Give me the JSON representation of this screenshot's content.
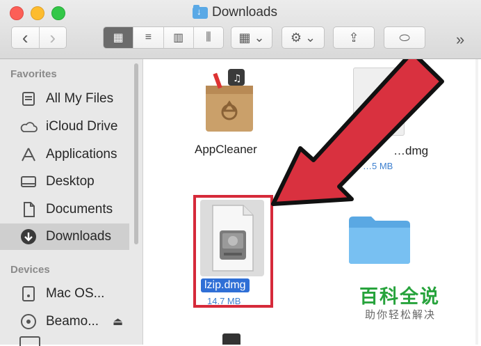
{
  "window": {
    "title": "Downloads"
  },
  "toolbar": {
    "back": "‹",
    "forward": "›",
    "view_icon": "▦",
    "view_list": "≡",
    "view_columns": "▥",
    "view_coverflow": "⫼",
    "arrange": "▦ ⌄",
    "action": "⚙ ⌄",
    "share": "⇪",
    "tags": "⬭",
    "overflow": "»"
  },
  "sidebar": {
    "favorites_header": "Favorites",
    "devices_header": "Devices",
    "favorites": [
      {
        "label": "All My Files",
        "icon": "all-my-files-icon"
      },
      {
        "label": "iCloud Drive",
        "icon": "cloud-icon"
      },
      {
        "label": "Applications",
        "icon": "applications-icon"
      },
      {
        "label": "Desktop",
        "icon": "desktop-icon"
      },
      {
        "label": "Documents",
        "icon": "documents-icon"
      },
      {
        "label": "Downloads",
        "icon": "downloads-icon",
        "selected": true
      }
    ],
    "devices": [
      {
        "label": "Mac OS...",
        "icon": "hard-drive-icon"
      },
      {
        "label": "Beamo...",
        "icon": "disc-icon",
        "eject": "⏏"
      }
    ]
  },
  "files": [
    {
      "name": "AppCleaner",
      "icon": "app-box-icon"
    },
    {
      "name": "…dmg",
      "size": "…5 MB",
      "icon": "dmg-icon"
    },
    {
      "name": "lzip.dmg",
      "size": "14.7 MB",
      "icon": "dmg-icon",
      "selected": true
    },
    {
      "name": "",
      "icon": "folder-icon"
    }
  ],
  "watermark": {
    "title": "百科全说",
    "subtitle": "助你轻松解决"
  },
  "colors": {
    "highlight": "#d62a3a",
    "arrow": "#d9313f",
    "selection": "#2f6fd6",
    "folder": "#6cb8ef",
    "watermark": "#27a33c"
  }
}
